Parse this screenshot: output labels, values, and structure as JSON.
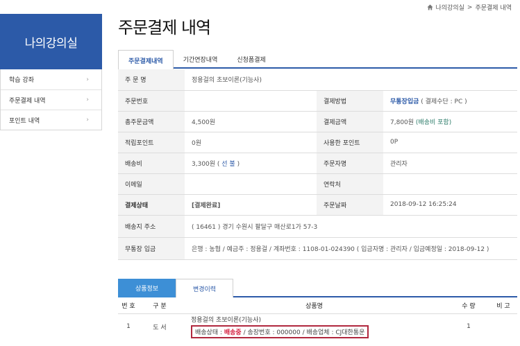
{
  "breadcrumb": {
    "items": [
      "나의강의실",
      "주문결제 내역"
    ],
    "sep": ">"
  },
  "sidebar": {
    "title": "나의강의실",
    "items": [
      {
        "label": "학습 강좌"
      },
      {
        "label": "주문결제 내역"
      },
      {
        "label": "포인트 내역"
      }
    ]
  },
  "page": {
    "title": "주문결제 내역"
  },
  "tabs": [
    "주문결제내역",
    "기간연장내역",
    "신청폼결제"
  ],
  "order": {
    "order_name_label": "주 문 명",
    "order_name": "정용걸의 초보이론(기능사)",
    "order_no_label": "주문번호",
    "order_no": "",
    "pay_method_label": "결제방법",
    "pay_method": "무통장입금",
    "pay_means": "( 결제수단 : PC )",
    "total_label": "총주문금액",
    "total": "4,500원",
    "pay_amount_label": "결제금액",
    "pay_amount": "7,800원",
    "pay_amount_note": "(배송비 포함)",
    "earn_point_label": "적립포인트",
    "earn_point": "0원",
    "used_point_label": "사용한 포인트",
    "used_point": "0P",
    "ship_fee_label": "배송비",
    "ship_fee": "3,300원 ( ",
    "ship_fee_type": "선 불",
    "ship_fee_close": " )",
    "orderer_label": "주문자명",
    "orderer": "관리자",
    "email_label": "이메일",
    "email": "",
    "contact_label": "연락처",
    "contact": "",
    "status_label": "결제상태",
    "status": "[결제완료]",
    "order_date_label": "주문날짜",
    "order_date": "2018-09-12 16:25:24",
    "address_label": "배송지 주소",
    "address": "( 16461 ) 경기 수원시 팔달구 매산로1가 57-3",
    "bank_label": "무통장 입금",
    "bank": "은행 : 농협 / 예금주 : 정용걸 / 계좌번호 : 1108-01-024390 ( 입금자명 : 관리자 / 입금예정일 : 2018-09-12 )"
  },
  "tabs2": [
    "상품정보",
    "변경이력"
  ],
  "products": {
    "headers": [
      "번 호",
      "구 분",
      "상품명",
      "수 량",
      "비 고"
    ],
    "rows": [
      {
        "no": "1",
        "type": "도 서",
        "name": "정용걸의 초보이론(기능사)",
        "ship_prefix": "배송상태 : ",
        "ship_status": "배송중",
        "ship_suffix": " / 송장번호 : 000000 / 배송업체 : CJ대한통운",
        "qty": "1",
        "note": ""
      }
    ]
  },
  "colors": {
    "brand": "#2c5aa8",
    "tab_active": "#3d8fd6",
    "highlight_border": "#b0273d",
    "status_red": "#d41c3c"
  }
}
